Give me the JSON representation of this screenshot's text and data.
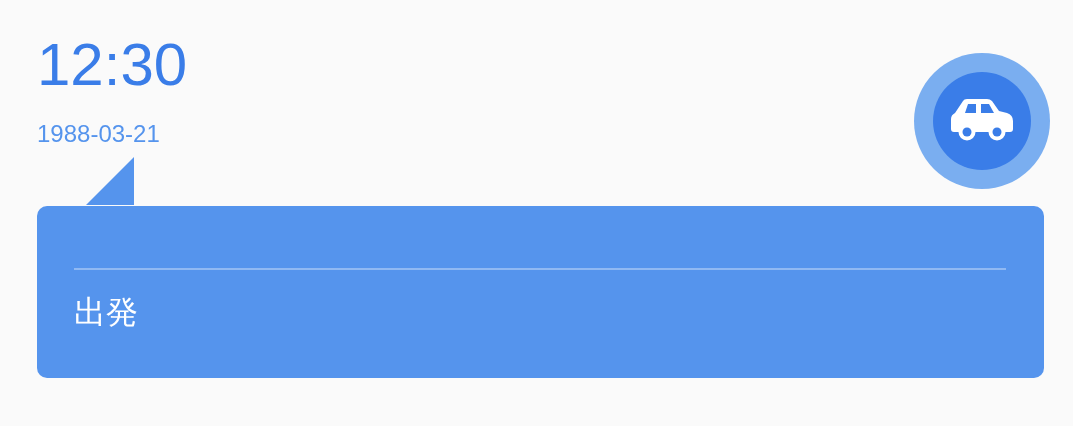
{
  "time": "12:30",
  "date": "1988-03-21",
  "card": {
    "title": "出発"
  }
}
